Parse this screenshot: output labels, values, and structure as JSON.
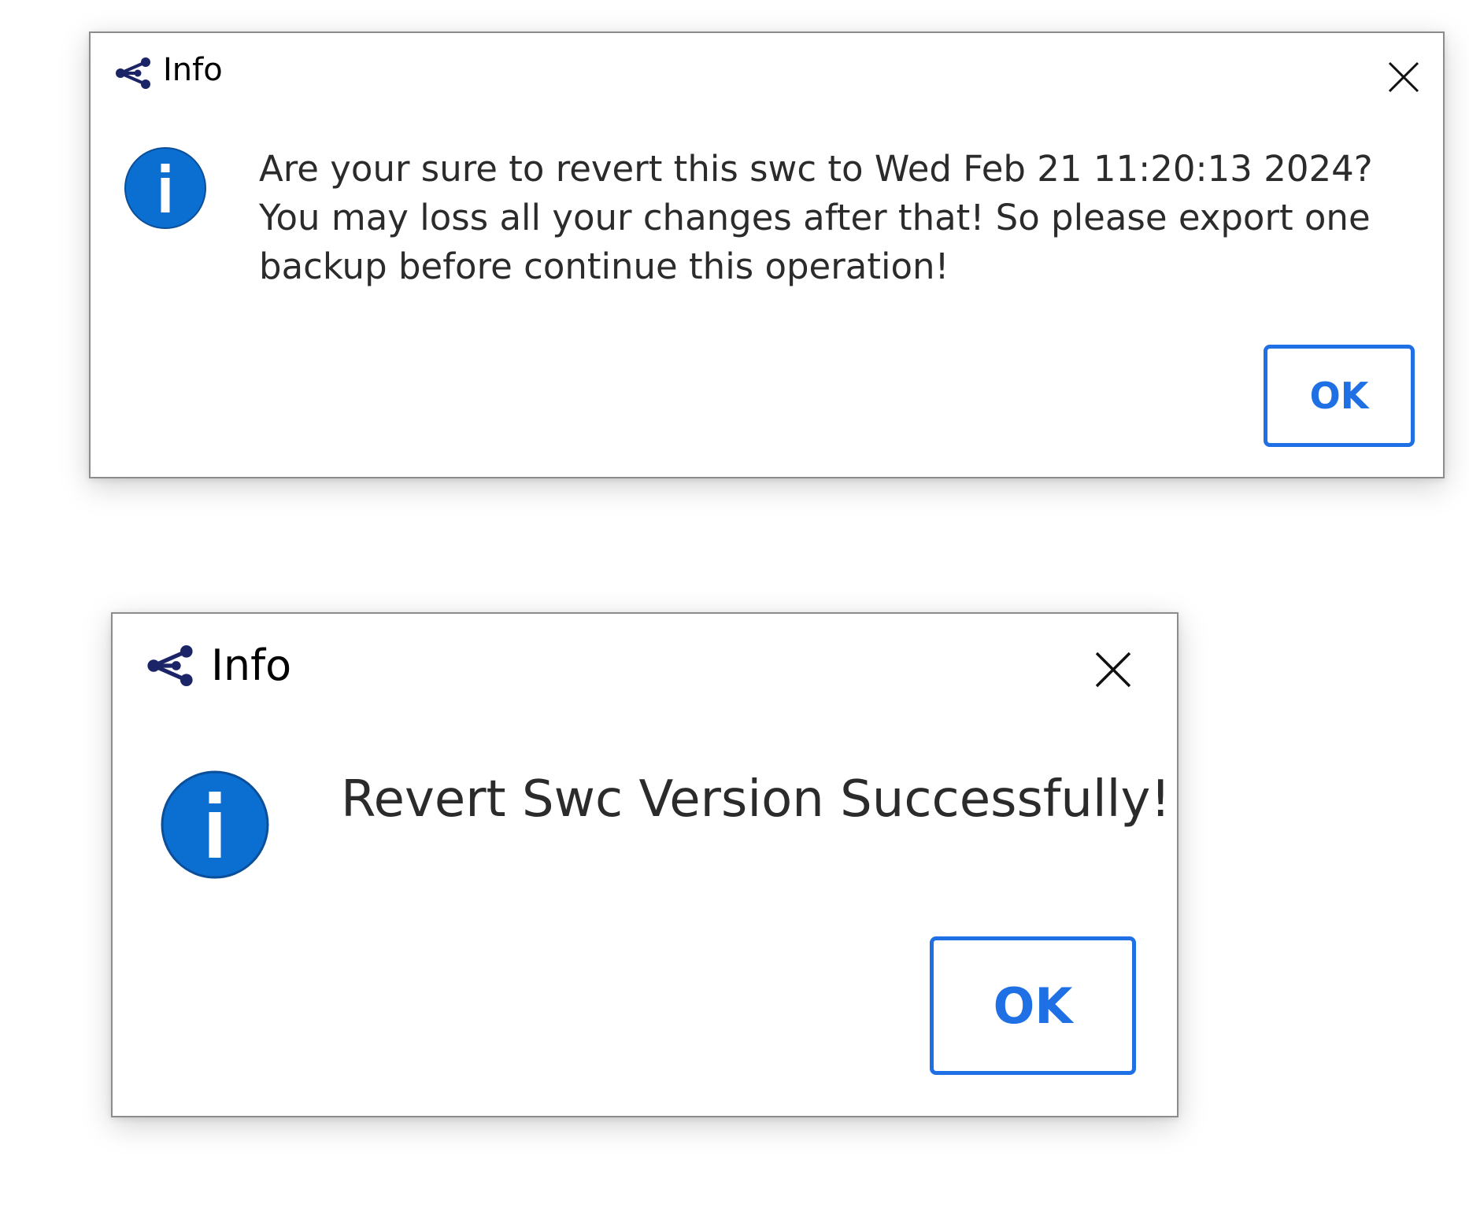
{
  "colors": {
    "accent": "#1f6fe5",
    "info_icon_fill": "#0a6fd0",
    "app_icon": "#1a2466",
    "text": "#2b2b2b"
  },
  "dialogs": [
    {
      "title": "Info",
      "icon": "share-node-icon",
      "message_lines": [
        "Are your sure to revert this swc to Wed Feb 21 11:20:13 2024?",
        "You may loss all your changes after that! So please export one",
        "backup before continue this operation!"
      ],
      "ok_label": "OK"
    },
    {
      "title": "Info",
      "icon": "share-node-icon",
      "message": "Revert Swc Version Successfully!",
      "ok_label": "OK"
    }
  ]
}
